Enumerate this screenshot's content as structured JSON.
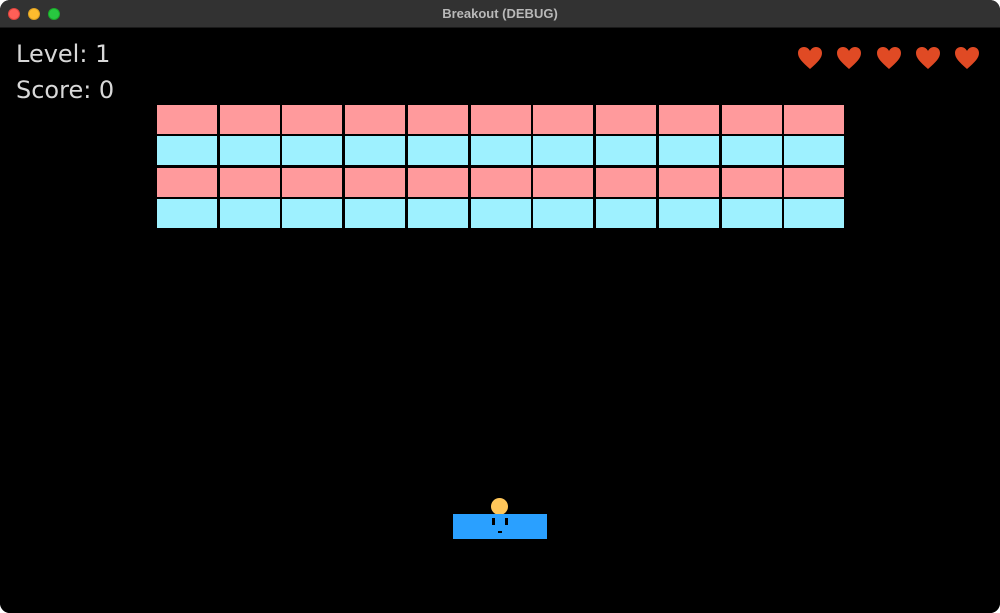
{
  "window": {
    "title": "Breakout (DEBUG)"
  },
  "hud": {
    "level_text": "Level: 1",
    "score_text": "Score: 0",
    "lives": 5
  },
  "bricks": {
    "rows": 4,
    "columns": 11,
    "row_colors": [
      "#ff9a9c",
      "#9ef1ff",
      "#ff9a9c",
      "#9ef1ff"
    ]
  },
  "colors": {
    "background": "#000000",
    "heart": "#e04a24",
    "paddle": "#2aa0ff",
    "ball": "#ffc65a",
    "hud_text": "#d8d8d8"
  },
  "icons": {
    "life": "heart-icon"
  }
}
